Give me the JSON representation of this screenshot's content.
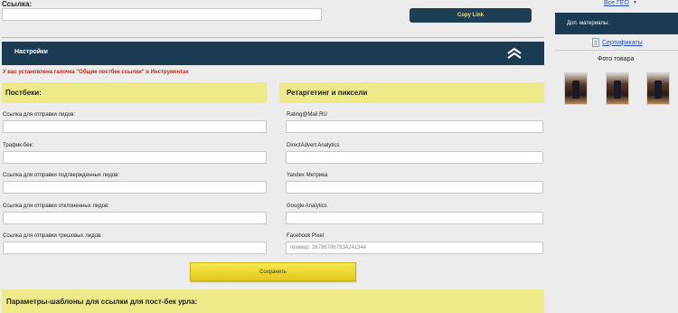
{
  "top": {
    "link_label": "Ссылка:",
    "copy_button": "Copy Link"
  },
  "settings": {
    "title": "Настройки",
    "warning": "У вас установлена галочка \"Общие постбек ссылки\" в Инструментах"
  },
  "postbacks": {
    "title": "Постбеки:",
    "fields": [
      {
        "label": "Ссылка для отправки лидов:",
        "value": ""
      },
      {
        "label": "Трафик-бек:",
        "value": ""
      },
      {
        "label": "Ссылка для отправки подтвержденных лидов:",
        "value": ""
      },
      {
        "label": "Ссылка для отправки отклоненных лидов:",
        "value": ""
      },
      {
        "label": "Ссылка для отправки трешовых лидов:",
        "value": ""
      }
    ]
  },
  "retargeting": {
    "title": "Ретаргетинг и пиксели",
    "fields": [
      {
        "label": "Rating@Mail.RU",
        "value": "",
        "placeholder": ""
      },
      {
        "label": "DirectAdvert Analytics",
        "value": "",
        "placeholder": ""
      },
      {
        "label": "Yandex Метрика",
        "value": "",
        "placeholder": ""
      },
      {
        "label": "Google Analytics",
        "value": "",
        "placeholder": ""
      },
      {
        "label": "Facebook Pixel",
        "value": "",
        "placeholder": "пример: 267867867834241344"
      }
    ]
  },
  "save_button": "Сохранить",
  "params_title": "Параметры-шаблоны для ссылки для пост-бек урла:",
  "sidebar": {
    "geo_link": "Все ГЕО",
    "geo_caret": "▼",
    "materials_title": "Доп. материалы:",
    "certificates_link": "Сертификаты",
    "photos_title": "Фото товара"
  }
}
